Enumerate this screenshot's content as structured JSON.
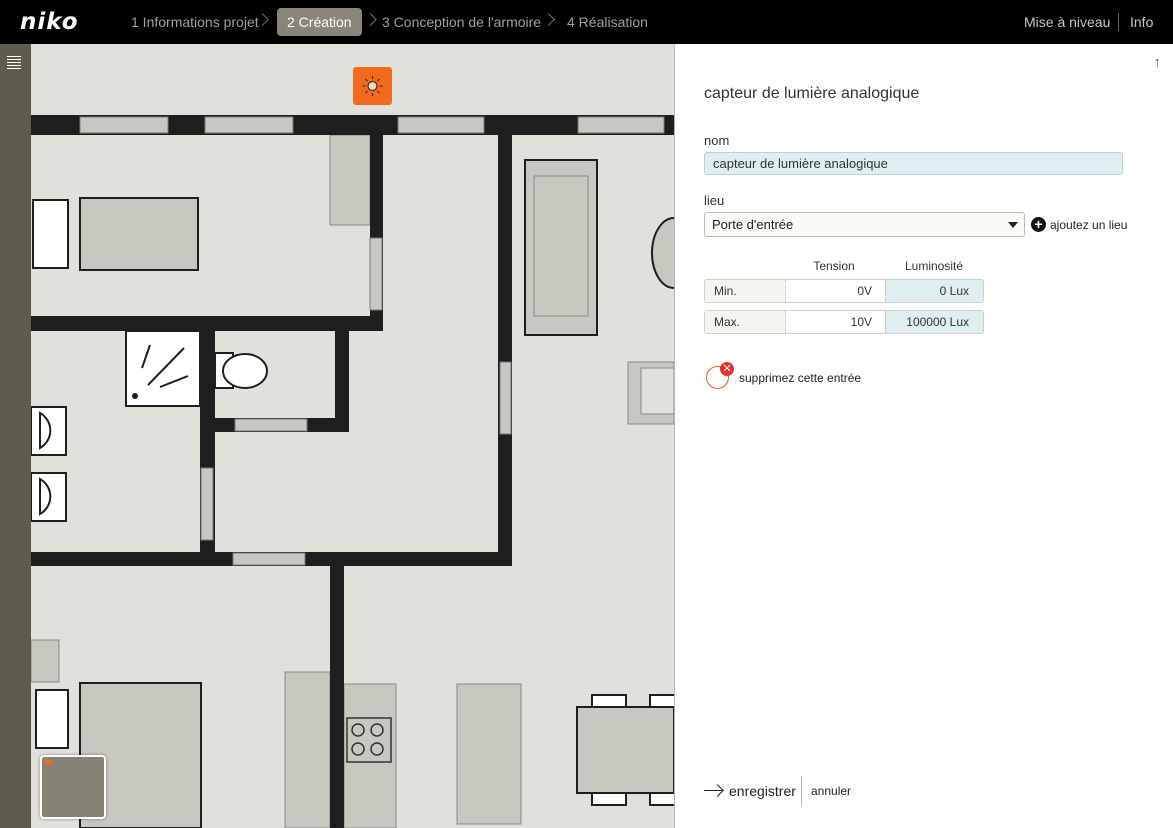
{
  "header": {
    "logo": "niko",
    "steps": [
      {
        "label": "1 Informations projet",
        "active": false
      },
      {
        "label": "2 Création",
        "active": true
      },
      {
        "label": "3 Conception de l'armoire",
        "active": false
      },
      {
        "label": "4 Réalisation",
        "active": false
      }
    ],
    "upgrade_label": "Mise à niveau",
    "info_label": "Info"
  },
  "colors": {
    "topbar": "#000000",
    "active_step": "#898578",
    "accent_orange": "#f26a1b",
    "input_fill": "#dfeef1",
    "left_strip": "#5d5c4f",
    "plan_floor": "#e1e0da",
    "wall": "#1e1e1e",
    "furniture": "#c8c7c0"
  },
  "icons": {
    "menu": "hamburger-icon",
    "sensor": "light-sensor-icon",
    "collapse": "arrow-up-icon",
    "add": "plus-circle-icon",
    "remove": "close-circle-icon",
    "save": "arrow-right-icon"
  },
  "panel": {
    "title": "capteur de lumière analogique",
    "name_label": "nom",
    "name_value": "capteur de lumière analogique",
    "location_label": "lieu",
    "location_value": "Porte d'entrée",
    "add_location": "ajoutez un lieu",
    "table": {
      "headers": [
        "Tension",
        "Luminosité"
      ],
      "rows": [
        {
          "label": "Min.",
          "tension": "0V",
          "luminosite": "0 Lux"
        },
        {
          "label": "Max.",
          "tension": "10V",
          "luminosite": "100000 Lux"
        }
      ]
    },
    "remove_label": "supprimez cette entrée",
    "save_label": "enregistrer",
    "cancel_label": "annuler"
  }
}
